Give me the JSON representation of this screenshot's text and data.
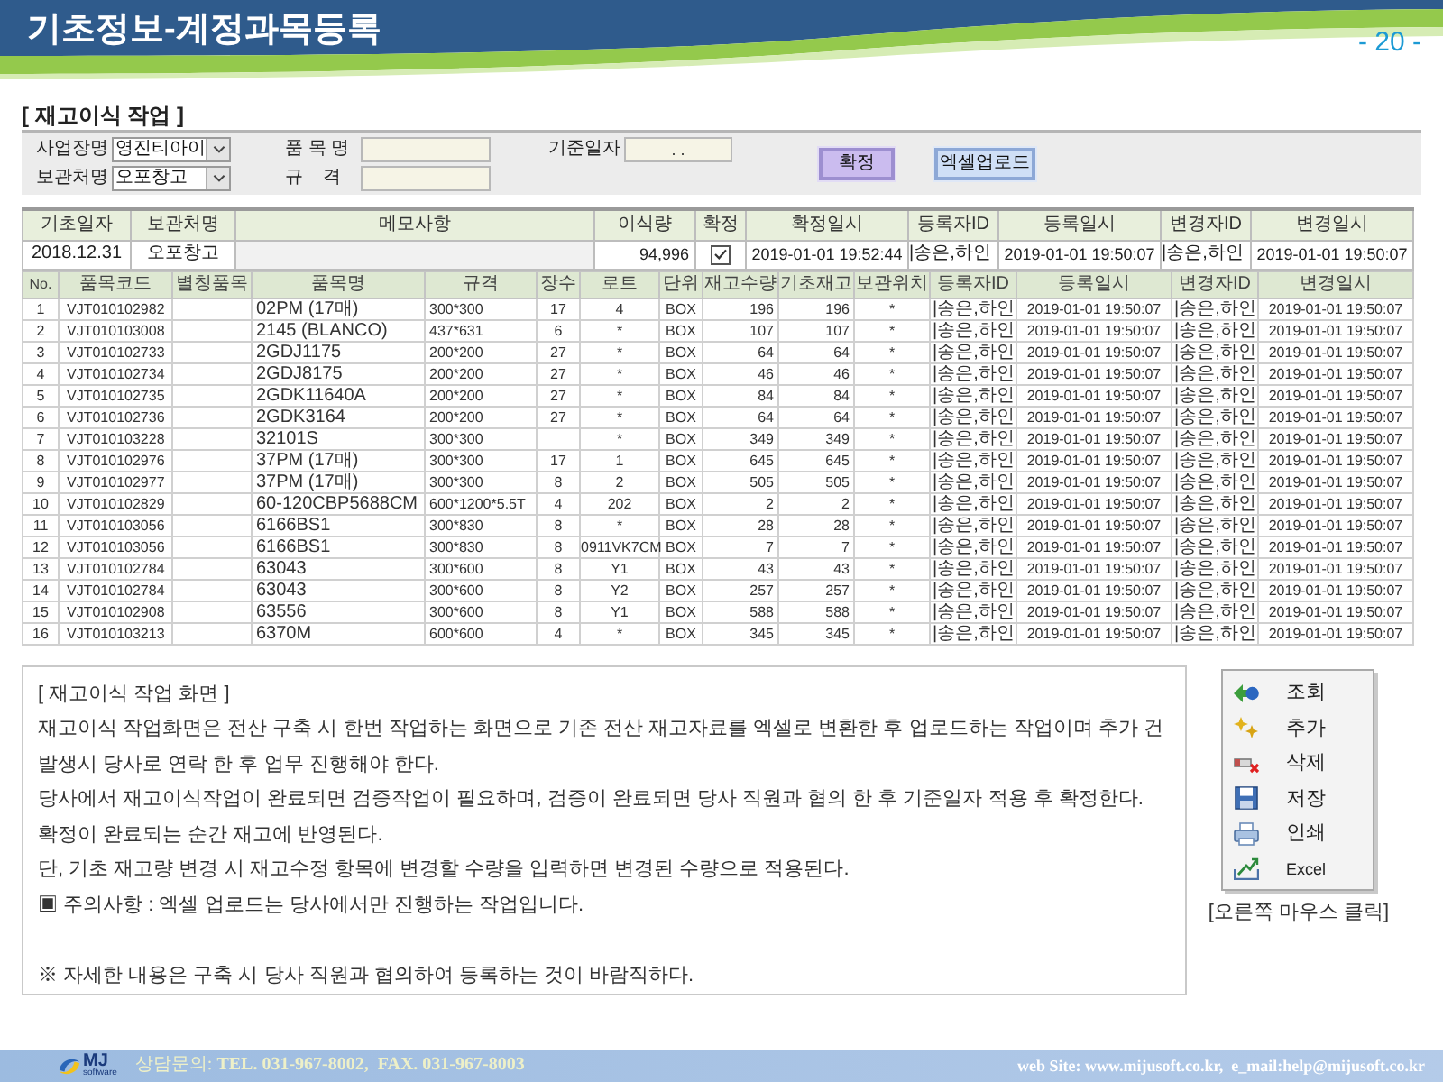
{
  "header": {
    "title": "기초정보-계정과목등록",
    "page_number": "- 20 -"
  },
  "section_title": "[ 재고이식 작업 ]",
  "filters": {
    "fields": [
      {
        "label": "사업장명",
        "kind": "select",
        "value": "영진티아이"
      },
      {
        "label": "보관처명",
        "kind": "select",
        "value": "오포창고"
      },
      {
        "label": "품 목 명",
        "kind": "input"
      },
      {
        "label": "규    격",
        "kind": "input"
      },
      {
        "label": "기준일자",
        "kind": "date",
        "value": ". ."
      }
    ],
    "buttons": [
      {
        "label": "확정",
        "kind": "confirm"
      },
      {
        "label": "엑셀업로드",
        "kind": "upload"
      }
    ]
  },
  "summary": {
    "columns": [
      "기초일자",
      "보관처명",
      "메모사항",
      "이식량",
      "확정",
      "확정일시",
      "등록자ID",
      "등록일시",
      "변경자ID",
      "변경일시"
    ],
    "row": {
      "base_date": "2018.12.31",
      "storage": "오포창고",
      "quantity": "94,996",
      "confirmed": true,
      "confirmed_at": "2019-01-01 19:52:44",
      "registered_by": "|송은,하인",
      "registered_at": "2019-01-01 19:50:07",
      "changed_by": "|송은,하인",
      "changed_at": "2019-01-01 19:50:07"
    }
  },
  "table": {
    "columns": [
      "No.",
      "품목코드",
      "별칭품목",
      "품목명",
      "규격",
      "장수",
      "로트",
      "단위",
      "재고수량",
      "기초재고",
      "보관위치",
      "등록자ID",
      "등록일시",
      "변경자ID",
      "변경일시"
    ],
    "rows": [
      {
        "no": "1",
        "code": "VJT010102982",
        "name": "02PM (17매)",
        "spec": "300*300",
        "sheets": "17",
        "lot": "4",
        "unit": "BOX",
        "stock": "196",
        "base_stock": "196",
        "location": "*",
        "registered_by": "|송은,하인",
        "registered_at": "2019-01-01 19:50:07",
        "changed_by": "|송은,하인",
        "changed_at": "2019-01-01 19:50:07"
      },
      {
        "no": "2",
        "code": "VJT010103008",
        "name": "2145 (BLANCO)",
        "spec": "437*631",
        "sheets": "6",
        "lot": "*",
        "unit": "BOX",
        "stock": "107",
        "base_stock": "107",
        "location": "*",
        "registered_by": "|송은,하인",
        "registered_at": "2019-01-01 19:50:07",
        "changed_by": "|송은,하인",
        "changed_at": "2019-01-01 19:50:07"
      },
      {
        "no": "3",
        "code": "VJT010102733",
        "name": "2GDJ1175",
        "spec": "200*200",
        "sheets": "27",
        "lot": "*",
        "unit": "BOX",
        "stock": "64",
        "base_stock": "64",
        "location": "*",
        "registered_by": "|송은,하인",
        "registered_at": "2019-01-01 19:50:07",
        "changed_by": "|송은,하인",
        "changed_at": "2019-01-01 19:50:07"
      },
      {
        "no": "4",
        "code": "VJT010102734",
        "name": "2GDJ8175",
        "spec": "200*200",
        "sheets": "27",
        "lot": "*",
        "unit": "BOX",
        "stock": "46",
        "base_stock": "46",
        "location": "*",
        "registered_by": "|송은,하인",
        "registered_at": "2019-01-01 19:50:07",
        "changed_by": "|송은,하인",
        "changed_at": "2019-01-01 19:50:07"
      },
      {
        "no": "5",
        "code": "VJT010102735",
        "name": "2GDK11640A",
        "spec": "200*200",
        "sheets": "27",
        "lot": "*",
        "unit": "BOX",
        "stock": "84",
        "base_stock": "84",
        "location": "*",
        "registered_by": "|송은,하인",
        "registered_at": "2019-01-01 19:50:07",
        "changed_by": "|송은,하인",
        "changed_at": "2019-01-01 19:50:07"
      },
      {
        "no": "6",
        "code": "VJT010102736",
        "name": "2GDK3164",
        "spec": "200*200",
        "sheets": "27",
        "lot": "*",
        "unit": "BOX",
        "stock": "64",
        "base_stock": "64",
        "location": "*",
        "registered_by": "|송은,하인",
        "registered_at": "2019-01-01 19:50:07",
        "changed_by": "|송은,하인",
        "changed_at": "2019-01-01 19:50:07"
      },
      {
        "no": "7",
        "code": "VJT010103228",
        "name": "32101S",
        "spec": "300*300",
        "lot": "*",
        "unit": "BOX",
        "stock": "349",
        "base_stock": "349",
        "location": "*",
        "registered_by": "|송은,하인",
        "registered_at": "2019-01-01 19:50:07",
        "changed_by": "|송은,하인",
        "changed_at": "2019-01-01 19:50:07"
      },
      {
        "no": "8",
        "code": "VJT010102976",
        "name": "37PM (17매)",
        "spec": "300*300",
        "sheets": "17",
        "lot": "1",
        "unit": "BOX",
        "stock": "645",
        "base_stock": "645",
        "location": "*",
        "registered_by": "|송은,하인",
        "registered_at": "2019-01-01 19:50:07",
        "changed_by": "|송은,하인",
        "changed_at": "2019-01-01 19:50:07"
      },
      {
        "no": "9",
        "code": "VJT010102977",
        "name": "37PM (17매)",
        "spec": "300*300",
        "sheets": "8",
        "lot": "2",
        "unit": "BOX",
        "stock": "505",
        "base_stock": "505",
        "location": "*",
        "registered_by": "|송은,하인",
        "registered_at": "2019-01-01 19:50:07",
        "changed_by": "|송은,하인",
        "changed_at": "2019-01-01 19:50:07"
      },
      {
        "no": "10",
        "code": "VJT010102829",
        "name": "60-120CBP5688CM",
        "spec": "600*1200*5.5T",
        "sheets": "4",
        "lot": "202",
        "unit": "BOX",
        "stock": "2",
        "base_stock": "2",
        "location": "*",
        "registered_by": "|송은,하인",
        "registered_at": "2019-01-01 19:50:07",
        "changed_by": "|송은,하인",
        "changed_at": "2019-01-01 19:50:07"
      },
      {
        "no": "11",
        "code": "VJT010103056",
        "name": "6166BS1",
        "spec": "300*830",
        "sheets": "8",
        "lot": "*",
        "unit": "BOX",
        "stock": "28",
        "base_stock": "28",
        "location": "*",
        "registered_by": "|송은,하인",
        "registered_at": "2019-01-01 19:50:07",
        "changed_by": "|송은,하인",
        "changed_at": "2019-01-01 19:50:07"
      },
      {
        "no": "12",
        "code": "VJT010103056",
        "name": "6166BS1",
        "spec": "300*830",
        "sheets": "8",
        "lot": "0911VK7CM",
        "unit": "BOX",
        "stock": "7",
        "base_stock": "7",
        "location": "*",
        "registered_by": "|송은,하인",
        "registered_at": "2019-01-01 19:50:07",
        "changed_by": "|송은,하인",
        "changed_at": "2019-01-01 19:50:07"
      },
      {
        "no": "13",
        "code": "VJT010102784",
        "name": "63043",
        "spec": "300*600",
        "sheets": "8",
        "lot": "Y1",
        "unit": "BOX",
        "stock": "43",
        "base_stock": "43",
        "location": "*",
        "registered_by": "|송은,하인",
        "registered_at": "2019-01-01 19:50:07",
        "changed_by": "|송은,하인",
        "changed_at": "2019-01-01 19:50:07"
      },
      {
        "no": "14",
        "code": "VJT010102784",
        "name": "63043",
        "spec": "300*600",
        "sheets": "8",
        "lot": "Y2",
        "unit": "BOX",
        "stock": "257",
        "base_stock": "257",
        "location": "*",
        "registered_by": "|송은,하인",
        "registered_at": "2019-01-01 19:50:07",
        "changed_by": "|송은,하인",
        "changed_at": "2019-01-01 19:50:07"
      },
      {
        "no": "15",
        "code": "VJT010102908",
        "name": "63556",
        "spec": "300*600",
        "sheets": "8",
        "lot": "Y1",
        "unit": "BOX",
        "stock": "588",
        "base_stock": "588",
        "location": "*",
        "registered_by": "|송은,하인",
        "registered_at": "2019-01-01 19:50:07",
        "changed_by": "|송은,하인",
        "changed_at": "2019-01-01 19:50:07"
      },
      {
        "no": "16",
        "code": "VJT010103213",
        "name": "6370M",
        "spec": "600*600",
        "sheets": "4",
        "lot": "*",
        "unit": "BOX",
        "stock": "345",
        "base_stock": "345",
        "location": "*",
        "registered_by": "|송은,하인",
        "registered_at": "2019-01-01 19:50:07",
        "changed_by": "|송은,하인",
        "changed_at": "2019-01-01 19:50:07"
      }
    ]
  },
  "description": {
    "title": "[ 재고이식 작업 화면 ]",
    "paragraphs": [
      "재고이식 작업화면은 전산 구축 시 한번 작업하는 화면으로 기존 전산 재고자료를 엑셀로 변환한 후 업로드하는 작업이며 추가 건 발생시 당사로 연락 한 후 업무 진행해야 한다.",
      "당사에서 재고이식작업이 완료되면 검증작업이 필요하며, 검증이 완료되면 당사 직원과 협의 한 후 기준일자 적용 후 확정한다.",
      "확정이 완료되는 순간 재고에 반영된다.",
      "단, 기초 재고량 변경 시 재고수정 항목에 변경할 수량을 입력하면 변경된 수량으로 적용된다.",
      "▣ 주의사항 : 엑셀 업로드는 당사에서만 진행하는 작업입니다."
    ],
    "note": "※ 자세한 내용은 구축 시 당사 직원과 협의하여 등록하는 것이 바람직하다."
  },
  "context_menu": {
    "items": [
      {
        "label": "조회"
      },
      {
        "label": "추가"
      },
      {
        "label": "삭제"
      },
      {
        "label": "저장"
      },
      {
        "label": "인쇄"
      },
      {
        "label": "Excel"
      }
    ],
    "caption": "[오른쪽 마우스 클릭]"
  },
  "footer": {
    "logo_text": "MJ",
    "logo_subtext": "software",
    "contact": "상담문의: **TEL. 031-967-8002,  FAX. 031-967-8003**",
    "site": "web Site: www.mijusoft.co.kr,  e_mail:help@mijusoft.co.kr"
  }
}
